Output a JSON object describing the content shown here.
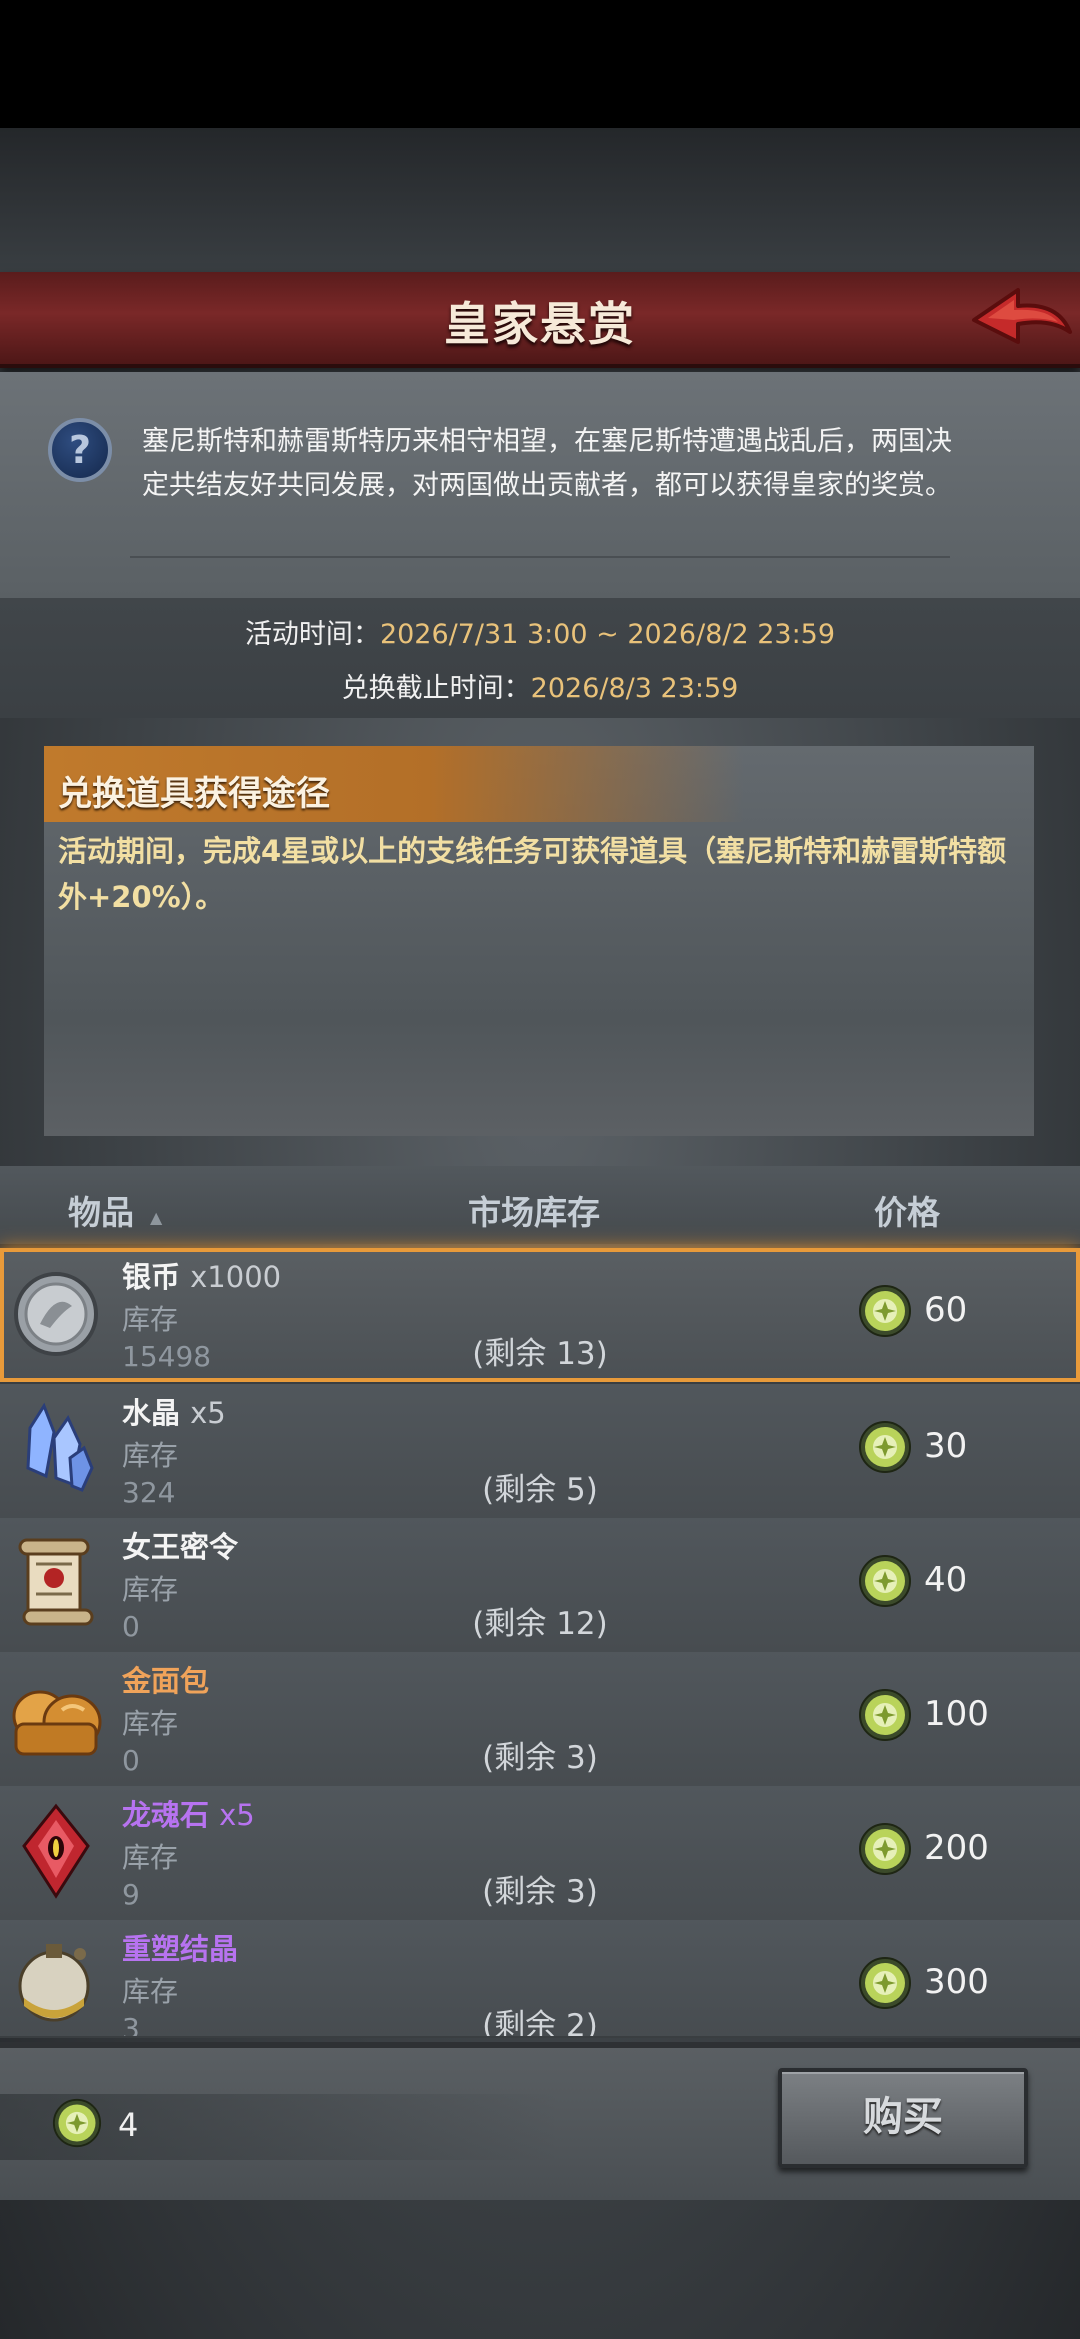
{
  "header": {
    "title": "皇家悬赏"
  },
  "intro": {
    "text": "塞尼斯特和赫雷斯特历来相守相望，在塞尼斯特遭遇战乱后，两国决定共结友好共同发展，对两国做出贡献者，都可以获得皇家的奖赏。"
  },
  "event": {
    "time_label": "活动时间：",
    "time_value": "2026/7/31 3:00 ~ 2026/8/2 23:59",
    "deadline_label": "兑换截止时间：",
    "deadline_value": "2026/8/3 23:59"
  },
  "route": {
    "title": "兑换道具获得途径",
    "text": "活动期间，完成4星或以上的支线任务可获得道具（塞尼斯特和赫雷斯特额外+20%）。"
  },
  "columns": {
    "item": "物品",
    "stock": "市场库存",
    "price": "价格"
  },
  "items": [
    {
      "name": "银币",
      "qty": "x1000",
      "stock_label": "库存",
      "stock": "15498",
      "remain": "(剩余 13)",
      "price": "60",
      "icon": "silver-coin-icon",
      "color": "white"
    },
    {
      "name": "水晶",
      "qty": "x5",
      "stock_label": "库存",
      "stock": "324",
      "remain": "(剩余 5)",
      "price": "30",
      "icon": "crystal-icon",
      "color": "white"
    },
    {
      "name": "女王密令",
      "qty": "",
      "stock_label": "库存",
      "stock": "0",
      "remain": "(剩余 12)",
      "price": "40",
      "icon": "scroll-icon",
      "color": "white"
    },
    {
      "name": "金面包",
      "qty": "",
      "stock_label": "库存",
      "stock": "0",
      "remain": "(剩余 3)",
      "price": "100",
      "icon": "bread-icon",
      "color": "#f0a35a"
    },
    {
      "name": "龙魂石",
      "qty": "x5",
      "stock_label": "库存",
      "stock": "9",
      "remain": "(剩余 3)",
      "price": "200",
      "icon": "dragon-soul-stone-icon",
      "color": "#b773f0"
    },
    {
      "name": "重塑结晶",
      "qty": "",
      "stock_label": "库存",
      "stock": "3",
      "remain": "(剩余 2)",
      "price": "300",
      "icon": "reshape-crystal-icon",
      "color": "#b773f0"
    }
  ],
  "wallet": {
    "amount": "4",
    "icon": "event-token-icon"
  },
  "buy_label": "购买"
}
